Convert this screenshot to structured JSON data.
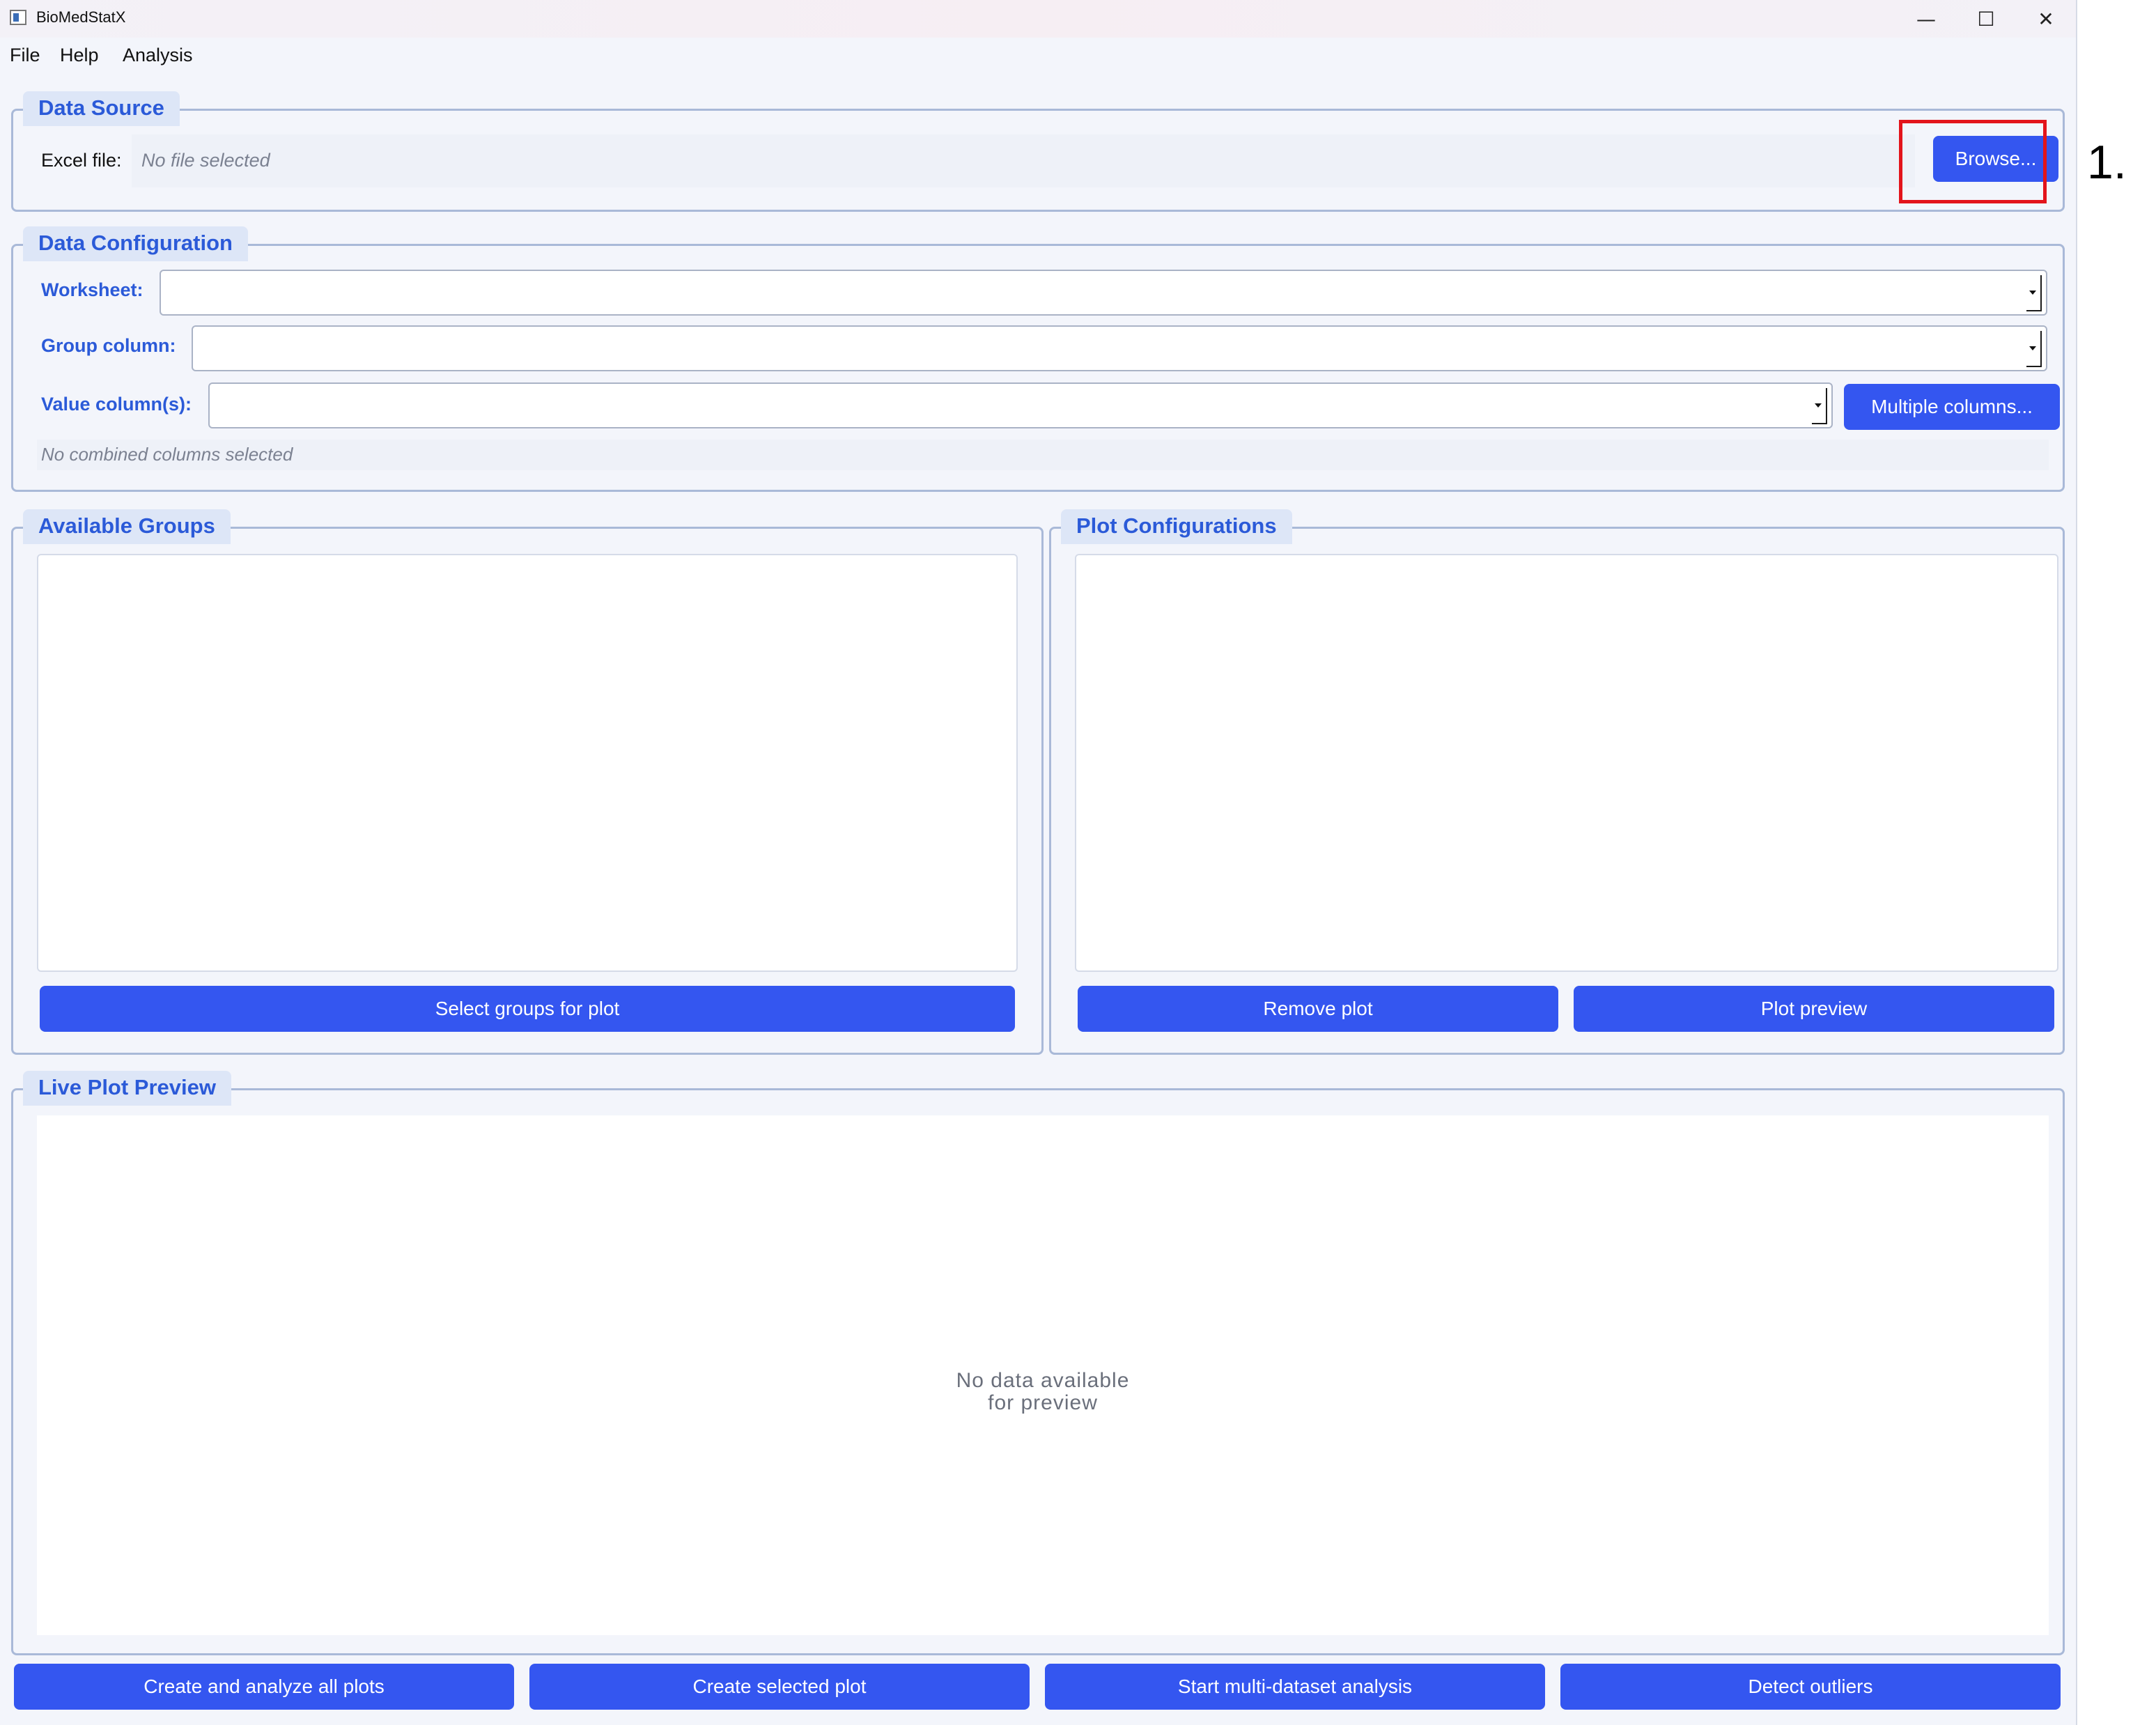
{
  "window": {
    "title": "BioMedStatX",
    "minimize_glyph": "—",
    "maximize_glyph": "☐",
    "close_glyph": "✕"
  },
  "menu": {
    "items": [
      "File",
      "Help",
      "Analysis"
    ]
  },
  "data_source": {
    "title": "Data Source",
    "excel_label": "Excel file:",
    "file_status": "No file selected",
    "browse_label": "Browse..."
  },
  "data_configuration": {
    "title": "Data Configuration",
    "worksheet_label": "Worksheet:",
    "group_column_label": "Group column:",
    "value_columns_label": "Value column(s):",
    "multiple_columns_label": "Multiple columns...",
    "combined_status": "No combined columns selected"
  },
  "available_groups": {
    "title": "Available Groups",
    "select_button": "Select groups for plot"
  },
  "plot_configurations": {
    "title": "Plot Configurations",
    "remove_button": "Remove plot",
    "preview_button": "Plot preview"
  },
  "live_preview": {
    "title": "Live Plot Preview",
    "message_line1": "No data available",
    "message_line2": "for preview"
  },
  "bottom_bar": {
    "create_all": "Create and analyze all plots",
    "create_selected": "Create selected plot",
    "multi_dataset": "Start multi-dataset analysis",
    "detect_outliers": "Detect outliers"
  },
  "annotation": {
    "step_label": "1."
  },
  "colors": {
    "accent_button": "#3456f0",
    "group_title_text": "#2b5ad8",
    "highlight_box": "#e3141b"
  }
}
